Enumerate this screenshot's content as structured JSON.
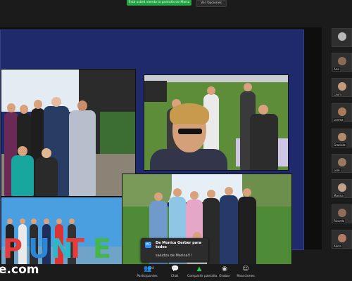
{
  "top_bar": {
    "banner_text": "Está usted viendo la pantalla de Marta",
    "view_options_label": "Ver Opciones"
  },
  "shared_slide": {
    "photos": [
      "group-photo-garden",
      "selfie-park-picnic",
      "letters-photo",
      "group-photo-park"
    ],
    "sign_letters": [
      "P",
      "U",
      "N",
      "T",
      "E"
    ],
    "sign_colors": [
      "#e23b3b",
      "#2a86d6",
      "#2fb6c9",
      "#e53c3c",
      "#45b649"
    ]
  },
  "participants_strip": {
    "tiles": [
      {
        "name": ""
      },
      {
        "name": "Ana"
      },
      {
        "name": "Laura"
      },
      {
        "name": "Lorena"
      },
      {
        "name": "Graciela"
      },
      {
        "name": "Lore"
      },
      {
        "name": "Marina"
      },
      {
        "name": "Ricardo"
      },
      {
        "name": "Alicia"
      }
    ]
  },
  "chat_notification": {
    "avatar_initials": "MG",
    "sender": "De Monica Gerber para todos",
    "message": "saludos de Marina!!!"
  },
  "watermark": "e.com",
  "toolbar": {
    "participants": {
      "label": "Participantes",
      "count": "24"
    },
    "chat": {
      "label": "Chat"
    },
    "share": {
      "label": "Compartir pantalla"
    },
    "record": {
      "label": "Grabar"
    },
    "reactions": {
      "label": "Reacciones"
    }
  },
  "colors": {
    "share_green": "#2fc25b",
    "slide_background": "#1f2a6d",
    "toolbar_background": "#1b1b1b"
  },
  "icons": {
    "participants": "participants-icon",
    "chat": "chat-icon",
    "share": "share-screen-icon",
    "record": "record-icon",
    "reactions": "reactions-icon"
  }
}
